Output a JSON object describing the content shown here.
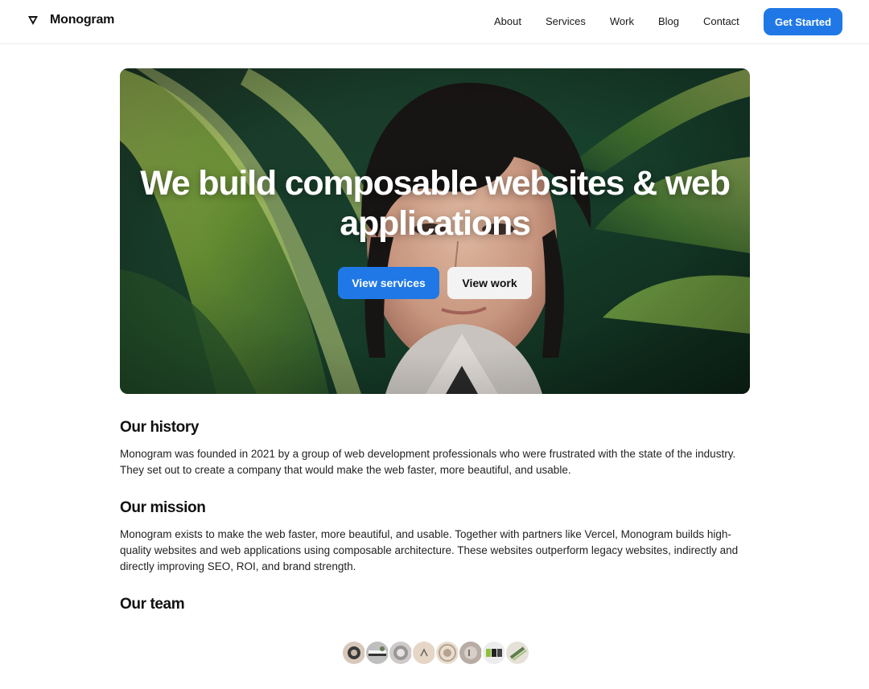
{
  "brand": {
    "name": "Monogram",
    "logo_icon": "monogram-logo-icon"
  },
  "nav": {
    "items": [
      {
        "label": "About"
      },
      {
        "label": "Services"
      },
      {
        "label": "Work"
      },
      {
        "label": "Blog"
      },
      {
        "label": "Contact"
      }
    ],
    "cta_label": "Get Started"
  },
  "hero": {
    "title": "We build composable websites & web applications",
    "primary_button": "View services",
    "secondary_button": "View work"
  },
  "sections": {
    "history": {
      "title": "Our history",
      "text": "Monogram was founded in 2021 by a group of web development professionals who were frustrated with the state of the industry. They set out to create a company that would make the web faster, more beautiful, and usable."
    },
    "mission": {
      "title": "Our mission",
      "text": "Monogram exists to make the web faster, more beautiful, and usable. Together with partners like Vercel, Monogram builds high-quality websites and web applications using composable architecture. These websites outperform legacy websites, indirectly and directly improving SEO, ROI, and brand strength."
    },
    "team": {
      "title": "Our team",
      "member_count": 8
    }
  },
  "colors": {
    "accent": "#1f78e6",
    "text": "#111111",
    "border": "#ececec",
    "button_secondary_bg": "#f3f3f3"
  }
}
